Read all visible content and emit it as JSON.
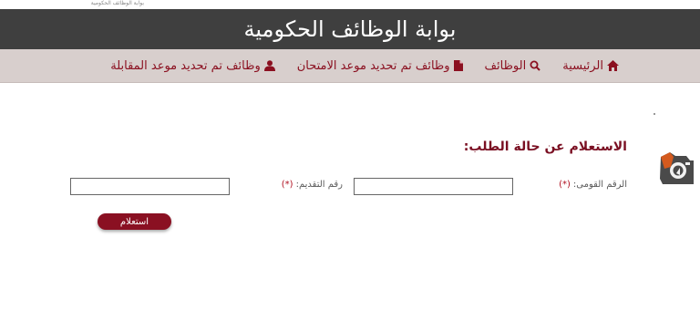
{
  "topline": {
    "text": "بوابة الوظائف الحكومية"
  },
  "header": {
    "title": "بوابة الوظائف الحكومية"
  },
  "nav": {
    "items": [
      {
        "label": "الرئيسية",
        "icon": "home-icon"
      },
      {
        "label": "الوظائف",
        "icon": "search-icon"
      },
      {
        "label": "وظائف تم تحديد موعد الامتحان",
        "icon": "document-icon"
      },
      {
        "label": "وظائف تم تحديد موعد المقابلة",
        "icon": "user-icon"
      }
    ]
  },
  "form": {
    "title": "الاستعلام عن حالة الطلب:",
    "national_id": {
      "label": "الرقم القومى:",
      "required": "(*)",
      "value": ""
    },
    "application_no": {
      "label": "رقم التقديم:",
      "required": "(*)",
      "value": ""
    },
    "submit_label": "استعلام"
  },
  "colors": {
    "header_bg": "#3f3f3f",
    "nav_bg": "#d8cfcd",
    "accent": "#8a1022"
  }
}
